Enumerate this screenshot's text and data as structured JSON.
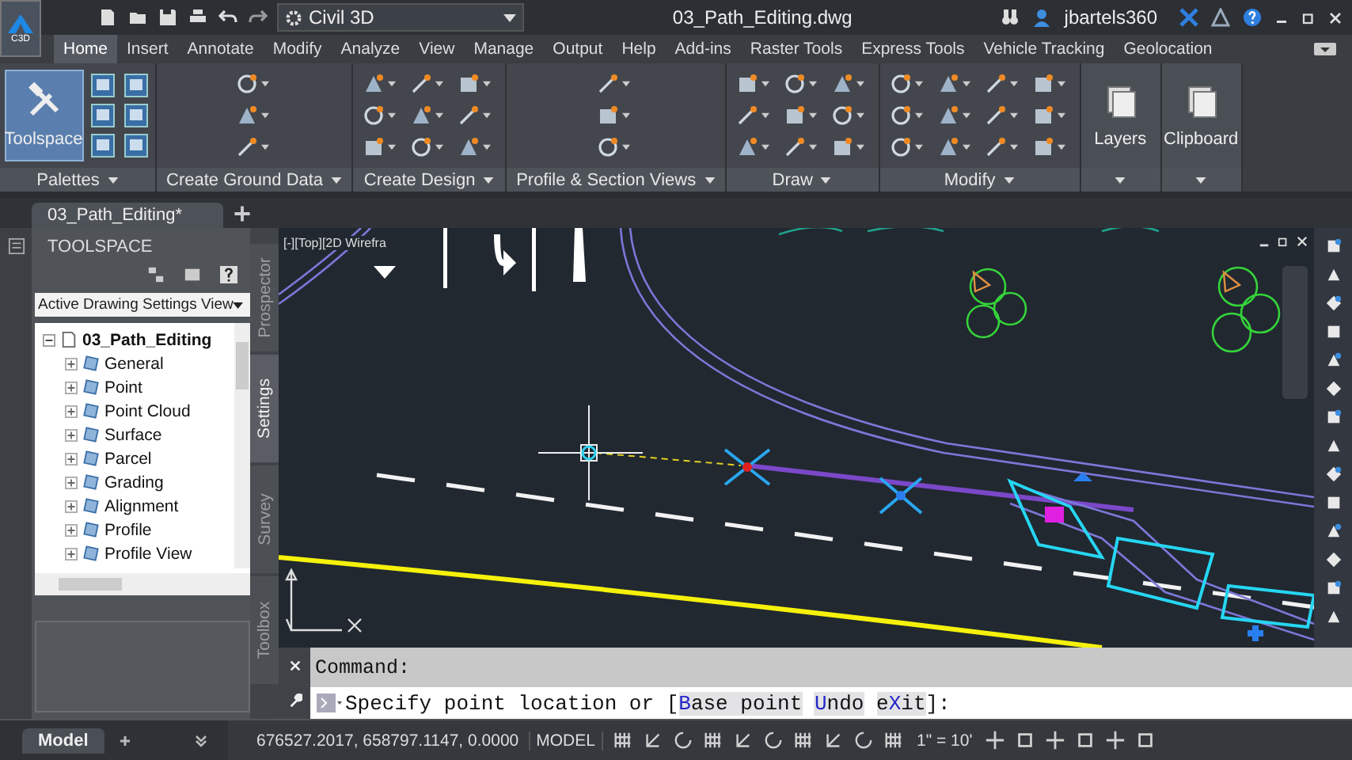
{
  "title_bar": {
    "app_badge": "C3D",
    "workspace": "Civil 3D",
    "title": "03_Path_Editing.dwg",
    "user": "jbartels360"
  },
  "ribbon_tabs": [
    {
      "label": "Home",
      "selected": true
    },
    {
      "label": "Insert",
      "selected": false
    },
    {
      "label": "Annotate",
      "selected": false
    },
    {
      "label": "Modify",
      "selected": false
    },
    {
      "label": "Analyze",
      "selected": false
    },
    {
      "label": "View",
      "selected": false
    },
    {
      "label": "Manage",
      "selected": false
    },
    {
      "label": "Output",
      "selected": false
    },
    {
      "label": "Help",
      "selected": false
    },
    {
      "label": "Add-ins",
      "selected": false
    },
    {
      "label": "Raster Tools",
      "selected": false
    },
    {
      "label": "Express Tools",
      "selected": false
    },
    {
      "label": "Vehicle Tracking",
      "selected": false
    },
    {
      "label": "Geolocation",
      "selected": false
    }
  ],
  "ribbon_panels": [
    {
      "label": "Palettes",
      "kind": "palettes",
      "big_button": "Toolspace"
    },
    {
      "label": "Create Ground Data",
      "kind": "tools"
    },
    {
      "label": "Create Design",
      "kind": "tools"
    },
    {
      "label": "Profile & Section Views",
      "kind": "tools"
    },
    {
      "label": "Draw",
      "kind": "tools"
    },
    {
      "label": "Modify",
      "kind": "tools"
    },
    {
      "kind": "big",
      "big_button": "Layers"
    },
    {
      "kind": "big",
      "big_button": "Clipboard"
    }
  ],
  "doc_tabs": [
    {
      "label": "03_Path_Editing*",
      "selected": true
    }
  ],
  "toolspace": {
    "title": "TOOLSPACE",
    "view": "Active Drawing Settings View",
    "tree": {
      "label": "03_Path_Editing",
      "expanded": true,
      "children": [
        {
          "label": "General"
        },
        {
          "label": "Point"
        },
        {
          "label": "Point Cloud"
        },
        {
          "label": "Surface"
        },
        {
          "label": "Parcel"
        },
        {
          "label": "Grading"
        },
        {
          "label": "Alignment"
        },
        {
          "label": "Profile"
        },
        {
          "label": "Profile View"
        }
      ]
    },
    "side_tabs": [
      {
        "label": "Prospector",
        "selected": false
      },
      {
        "label": "Settings",
        "selected": true
      },
      {
        "label": "Survey",
        "selected": false
      },
      {
        "label": "Toolbox",
        "selected": false
      }
    ]
  },
  "viewport": {
    "label": "[-][Top][2D Wirefra"
  },
  "command_line": {
    "history": "Command:",
    "prompt": "Specify point location or [",
    "options": [
      {
        "hotkey": "B",
        "rest": "ase point"
      },
      {
        "hotkey": "U",
        "rest": "ndo"
      },
      {
        "prefix": "e",
        "hotkey": "X",
        "rest": "it"
      }
    ],
    "end": "]:"
  },
  "status_bar": {
    "layout_tabs": [
      {
        "label": "Model",
        "selected": true
      }
    ],
    "coordinates": "676527.2017, 658797.1147, 0.0000",
    "space": "MODEL",
    "scale": "1\" = 10'"
  }
}
